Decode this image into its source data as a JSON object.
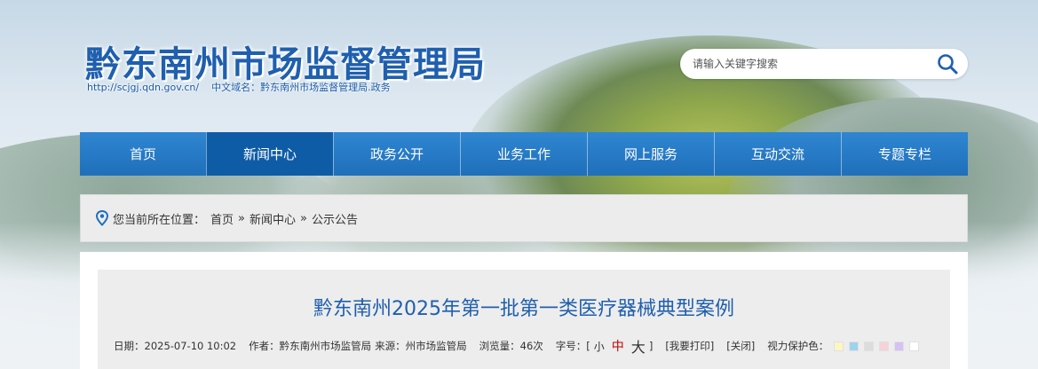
{
  "header": {
    "site_title": "黔东南州市场监督管理局",
    "site_url": "http://scjgj.qdn.gov.cn/",
    "domain_label": "中文域名：黔东南州市场监督管理局.政务"
  },
  "search": {
    "placeholder": "请输入关键字搜索",
    "icon": "search-icon"
  },
  "nav": {
    "items": [
      {
        "label": "首页"
      },
      {
        "label": "新闻中心"
      },
      {
        "label": "政务公开"
      },
      {
        "label": "业务工作"
      },
      {
        "label": "网上服务"
      },
      {
        "label": "互动交流"
      },
      {
        "label": "专题专栏"
      }
    ],
    "active_index": 1
  },
  "breadcrumb": {
    "prefix": "您当前所在位置：",
    "items": [
      "首页",
      "新闻中心",
      "公示公告"
    ],
    "separator": "»",
    "icon": "location-pin-icon"
  },
  "article": {
    "title": "黔东南州2025年第一批第一类医疗器械典型案例",
    "date": "日期：2025-07-10 10:02",
    "author": "作者：黔东南州市场监管局",
    "source": "来源：州市场监管局",
    "views": "浏览量：46次",
    "font_size_label": "字号：[",
    "font_small": "小",
    "font_mid": "中",
    "font_big": "大",
    "font_size_close": "]",
    "print": "[我要打印]",
    "close": "[关闭]",
    "eye_care_label": "视力保护色：",
    "eye_care_colors": [
      "#fbf6c2",
      "#9fd3ec",
      "#dcdcdc",
      "#f7d2dc",
      "#d6c2f2",
      "#ffffff"
    ]
  },
  "colors": {
    "brand_blue": "#1f5fae",
    "nav_blue": "#2f86d1",
    "nav_active": "#0f5ca6",
    "accent_red": "#c40000"
  }
}
